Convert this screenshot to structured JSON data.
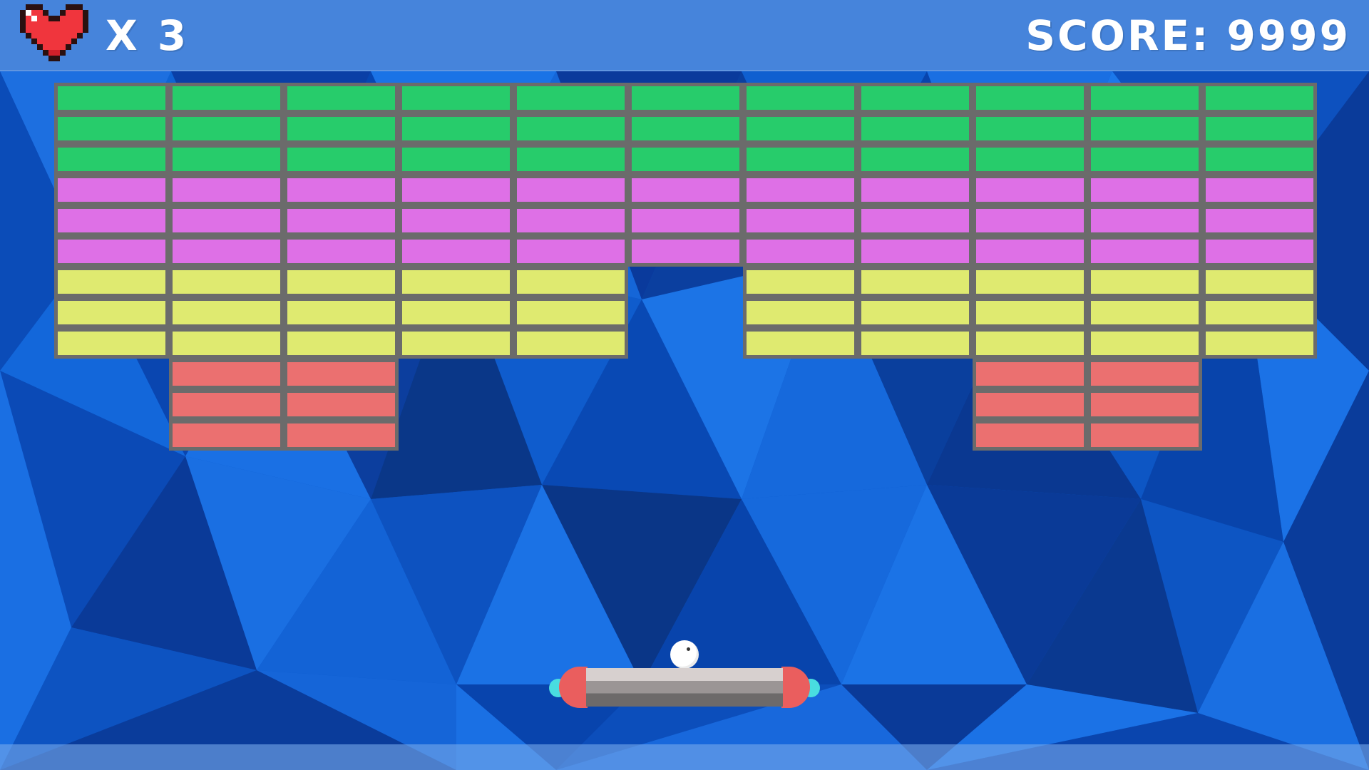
{
  "hud": {
    "lives_text": "X 3",
    "score_text": "SCORE: 9999",
    "lives_icon": "pixel-heart-icon"
  },
  "game_state": {
    "lives": 3,
    "score": 9999
  },
  "colors": {
    "background": "#0a4fbf",
    "brick_border": "#6b6b6b",
    "green": "#27cc6b",
    "magenta": "#de70e6",
    "yellow": "#dfea70",
    "red": "#eb7070",
    "paddle_caps": "#ea5e5e",
    "paddle_nubs": "#49dde0",
    "ball": "#ffffff"
  },
  "bricks": {
    "columns": 11,
    "rows": [
      {
        "color": "green",
        "cols": [
          0,
          1,
          2,
          3,
          4,
          5,
          6,
          7,
          8,
          9,
          10
        ]
      },
      {
        "color": "green",
        "cols": [
          0,
          1,
          2,
          3,
          4,
          5,
          6,
          7,
          8,
          9,
          10
        ]
      },
      {
        "color": "green",
        "cols": [
          0,
          1,
          2,
          3,
          4,
          5,
          6,
          7,
          8,
          9,
          10
        ]
      },
      {
        "color": "magenta",
        "cols": [
          0,
          1,
          2,
          3,
          4,
          5,
          6,
          7,
          8,
          9,
          10
        ]
      },
      {
        "color": "magenta",
        "cols": [
          0,
          1,
          2,
          3,
          4,
          5,
          6,
          7,
          8,
          9,
          10
        ]
      },
      {
        "color": "magenta",
        "cols": [
          0,
          1,
          2,
          3,
          4,
          5,
          6,
          7,
          8,
          9,
          10
        ]
      },
      {
        "color": "yellow",
        "cols": [
          0,
          1,
          2,
          3,
          4,
          6,
          7,
          8,
          9,
          10
        ]
      },
      {
        "color": "yellow",
        "cols": [
          0,
          1,
          2,
          3,
          4,
          6,
          7,
          8,
          9,
          10
        ]
      },
      {
        "color": "yellow",
        "cols": [
          0,
          1,
          2,
          3,
          4,
          6,
          7,
          8,
          9,
          10
        ]
      },
      {
        "color": "red",
        "cols": [
          1,
          2,
          8,
          9
        ]
      },
      {
        "color": "red",
        "cols": [
          1,
          2,
          8,
          9
        ]
      },
      {
        "color": "red",
        "cols": [
          1,
          2,
          8,
          9
        ]
      }
    ]
  }
}
